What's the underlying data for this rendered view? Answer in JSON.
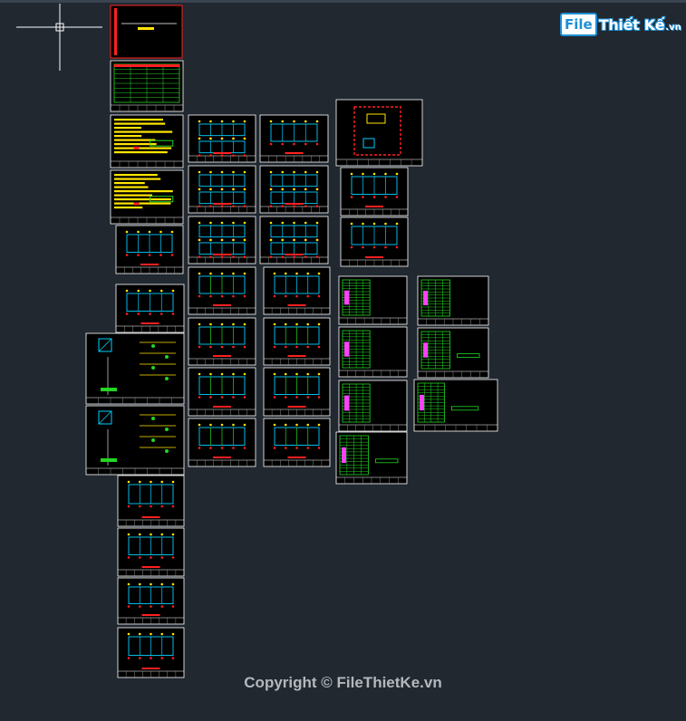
{
  "watermark": {
    "logo_file": "File",
    "logo_name": "Thiết Kế",
    "logo_domain": ".vn"
  },
  "copyright": "Copyright © FileThietKe.vn",
  "colors": {
    "background": "#212830",
    "sheet_border": "#ffffff",
    "drawing_cyan": "#00d0ff",
    "drawing_red": "#ff2020",
    "drawing_green": "#22d622",
    "drawing_yellow": "#ffe600",
    "drawing_magenta": "#ff40ff"
  },
  "icons": [
    "ucs-crosshair-icon",
    "logo-icon"
  ]
}
